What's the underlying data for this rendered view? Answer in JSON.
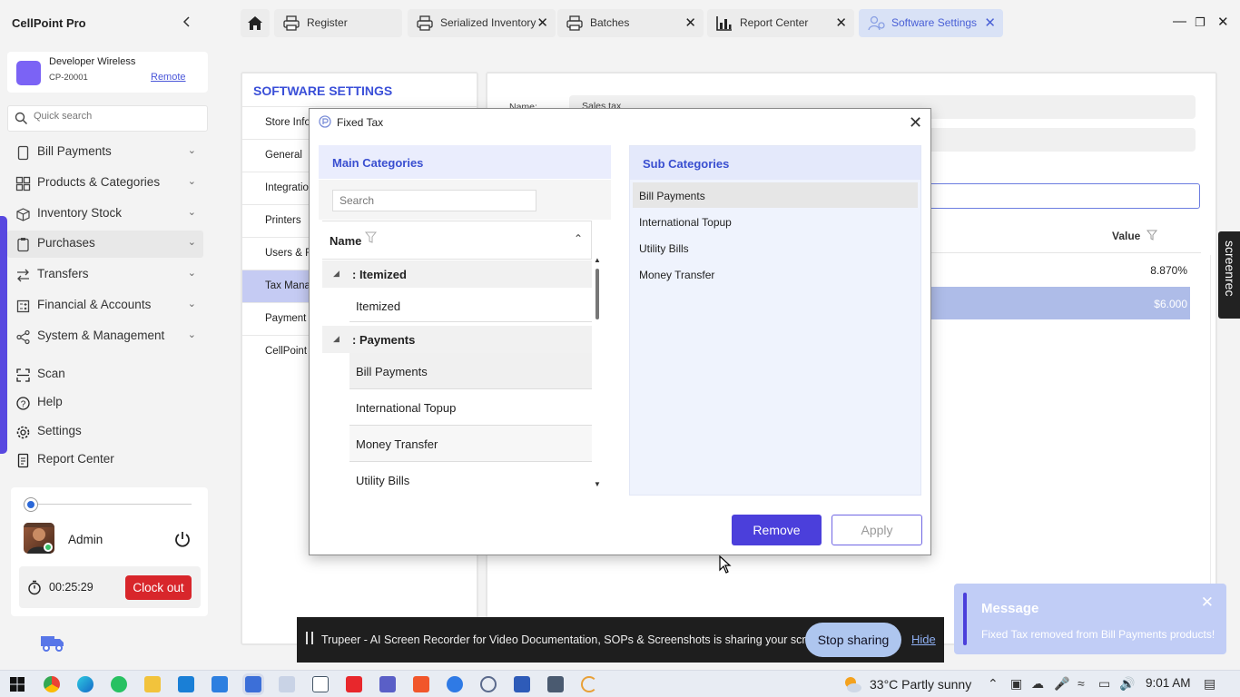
{
  "app": {
    "title": "CellPoint Pro"
  },
  "store": {
    "name": "Developer Wireless",
    "code": "CP-20001",
    "remote_label": "Remote"
  },
  "search": {
    "placeholder": "Quick search"
  },
  "nav": {
    "items": [
      {
        "label": "Bill Payments"
      },
      {
        "label": "Products & Categories"
      },
      {
        "label": "Inventory Stock"
      },
      {
        "label": "Purchases"
      },
      {
        "label": "Transfers"
      },
      {
        "label": "Financial & Accounts"
      },
      {
        "label": "System & Management"
      }
    ],
    "bottom": [
      {
        "label": "Scan"
      },
      {
        "label": "Help"
      },
      {
        "label": "Settings"
      },
      {
        "label": "Report Center"
      }
    ]
  },
  "user": {
    "name": "Admin",
    "timer": "00:25:29",
    "clockout_label": "Clock out"
  },
  "tabs": [
    {
      "label": "Register"
    },
    {
      "label": "Serialized Inventory"
    },
    {
      "label": "Batches"
    },
    {
      "label": "Report Center"
    },
    {
      "label": "Software Settings"
    }
  ],
  "settings": {
    "title": "SOFTWARE SETTINGS",
    "items": [
      {
        "label": "Store Info"
      },
      {
        "label": "General"
      },
      {
        "label": "Integratio"
      },
      {
        "label": "Printers"
      },
      {
        "label": "Users & R"
      },
      {
        "label": "Tax Manag"
      },
      {
        "label": "Payment T"
      },
      {
        "label": "CellPoint A"
      }
    ]
  },
  "tax_form": {
    "name_label": "Name:",
    "name_value": "Sales tax",
    "grid_value_header": "Value",
    "rows": [
      {
        "value": "8.870%"
      },
      {
        "value": "$6.000"
      }
    ]
  },
  "screenrec": {
    "label": "screenrec"
  },
  "modal": {
    "title": "Fixed Tax",
    "main_categories_title": "Main Categories",
    "search_placeholder": "Search",
    "name_header": "Name",
    "groups": [
      {
        "label": ": Itemized",
        "items": [
          "Itemized"
        ]
      },
      {
        "label": ": Payments",
        "items": [
          "Bill Payments",
          "International Topup",
          "Money Transfer",
          "Utility Bills"
        ]
      }
    ],
    "sub_categories_title": "Sub Categories",
    "sub_items": [
      "Bill Payments",
      "International Topup",
      "Utility Bills",
      "Money Transfer"
    ],
    "remove_label": "Remove",
    "apply_label": "Apply"
  },
  "share_bar": {
    "message": "Trupeer - AI Screen Recorder for Video Documentation, SOPs & Screenshots is sharing your screen.",
    "stop_label": "Stop sharing",
    "hide_label": "Hide"
  },
  "toast": {
    "title": "Message",
    "text": "Fixed Tax removed from Bill Payments products!"
  },
  "taskbar": {
    "weather": "33°C  Partly sunny",
    "time": "9:01 AM"
  },
  "colors": {
    "accent": "#4b3fdb",
    "danger": "#d8262b",
    "selection": "#c5cbf3"
  }
}
